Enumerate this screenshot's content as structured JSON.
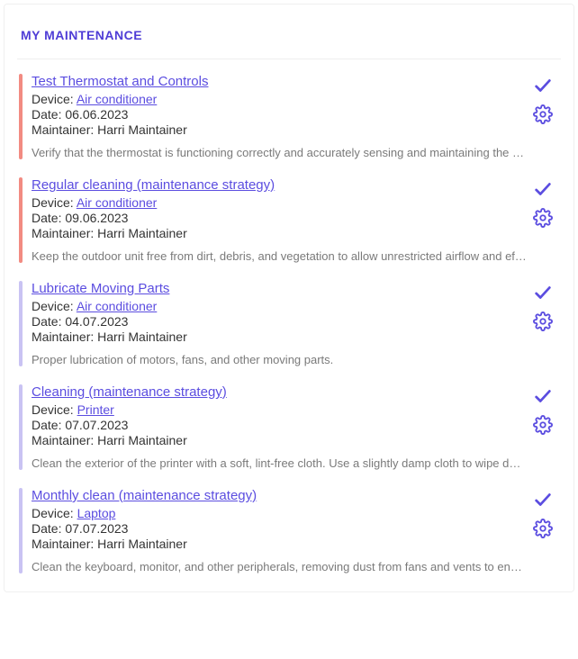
{
  "panel": {
    "title": "MY MAINTENANCE",
    "labels": {
      "device_prefix": "Device: ",
      "date_prefix": "Date: ",
      "maintainer_prefix": "Maintainer: "
    },
    "items": [
      {
        "title": "Test Thermostat and Controls",
        "device": "Air conditioner",
        "date": "06.06.2023",
        "maintainer": "Harri Maintainer",
        "status": "overdue",
        "description": "Verify that the thermostat is functioning correctly and accurately sensing and maintaining the desired temperature."
      },
      {
        "title": "Regular cleaning (maintenance strategy)",
        "device": "Air conditioner",
        "date": "09.06.2023",
        "maintainer": "Harri Maintainer",
        "status": "overdue",
        "description": "Keep the outdoor unit free from dirt, debris, and vegetation to allow unrestricted airflow and efficient operation."
      },
      {
        "title": "Lubricate Moving Parts",
        "device": "Air conditioner",
        "date": "04.07.2023",
        "maintainer": "Harri Maintainer",
        "status": "normal",
        "description": "Proper lubrication of motors, fans, and other moving parts."
      },
      {
        "title": "Cleaning (maintenance strategy)",
        "device": "Printer",
        "date": "07.07.2023",
        "maintainer": "Harri Maintainer",
        "status": "normal",
        "description": "Clean the exterior of the printer with a soft, lint-free cloth. Use a slightly damp cloth to wipe down surfaces and remove dust."
      },
      {
        "title": "Monthly clean (maintenance strategy)",
        "device": "Laptop",
        "date": "07.07.2023",
        "maintainer": "Harri Maintainer",
        "status": "normal",
        "description": "Clean the keyboard, monitor, and other peripherals, removing dust from fans and vents to ensure proper cooling."
      }
    ]
  },
  "icons": {
    "check": "check-icon",
    "gear": "gear-icon"
  }
}
